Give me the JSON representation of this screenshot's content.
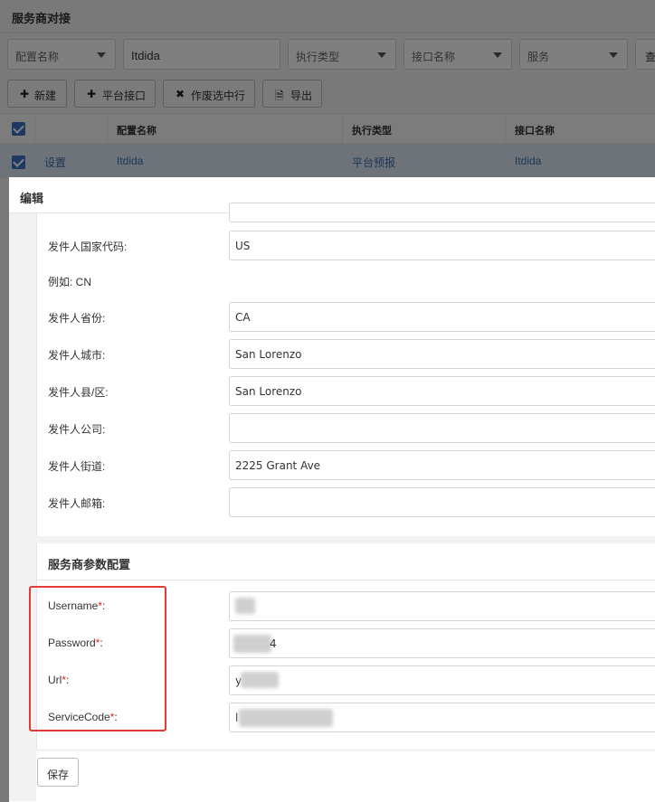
{
  "page": {
    "title": "服务商对接"
  },
  "filters": {
    "config_name_select": "配置名称",
    "config_name_value": "Itdida",
    "exec_type_select": "执行类型",
    "interface_name_select": "接口名称",
    "service_select": "服务",
    "query_label": "查"
  },
  "toolbar": {
    "new_label": "新建",
    "platform_interface_label": "平台接口",
    "void_label": "作废选中行",
    "export_label": "导出"
  },
  "table": {
    "headers": [
      "配置名称",
      "执行类型",
      "接口名称"
    ],
    "row": {
      "action": "设置",
      "config_name": "Itdida",
      "exec_type": "平台预报",
      "interface_name": "Itdida"
    }
  },
  "modal": {
    "title": "编辑",
    "fields": [
      {
        "label": "发件人国家代码:",
        "value": "US"
      },
      {
        "label": "例如: CN",
        "value": ""
      },
      {
        "label": "发件人省份:",
        "value": "CA"
      },
      {
        "label": "发件人城市:",
        "value": "San Lorenzo"
      },
      {
        "label": "发件人县/区:",
        "value": "San Lorenzo"
      },
      {
        "label": "发件人公司:",
        "value": ""
      },
      {
        "label": "发件人街道:",
        "value": "2225 Grant Ave"
      },
      {
        "label": "发件人邮箱:",
        "value": ""
      }
    ],
    "section_title": "服务商参数配置",
    "params": [
      {
        "label": "Username",
        "required": "*",
        "colon": ":",
        "value": ""
      },
      {
        "label": "Password",
        "required": "*",
        "colon": ":",
        "value": "4"
      },
      {
        "label": "Url",
        "required": "*",
        "colon": ":",
        "value": "y"
      },
      {
        "label": "ServiceCode",
        "required": "*",
        "colon": ":",
        "value": "l"
      }
    ],
    "save_label": "保存"
  },
  "colors": {
    "accent": "#3a73c4",
    "link": "#3a6fb0",
    "required": "#e02424",
    "highlight_box": "#e53935"
  }
}
